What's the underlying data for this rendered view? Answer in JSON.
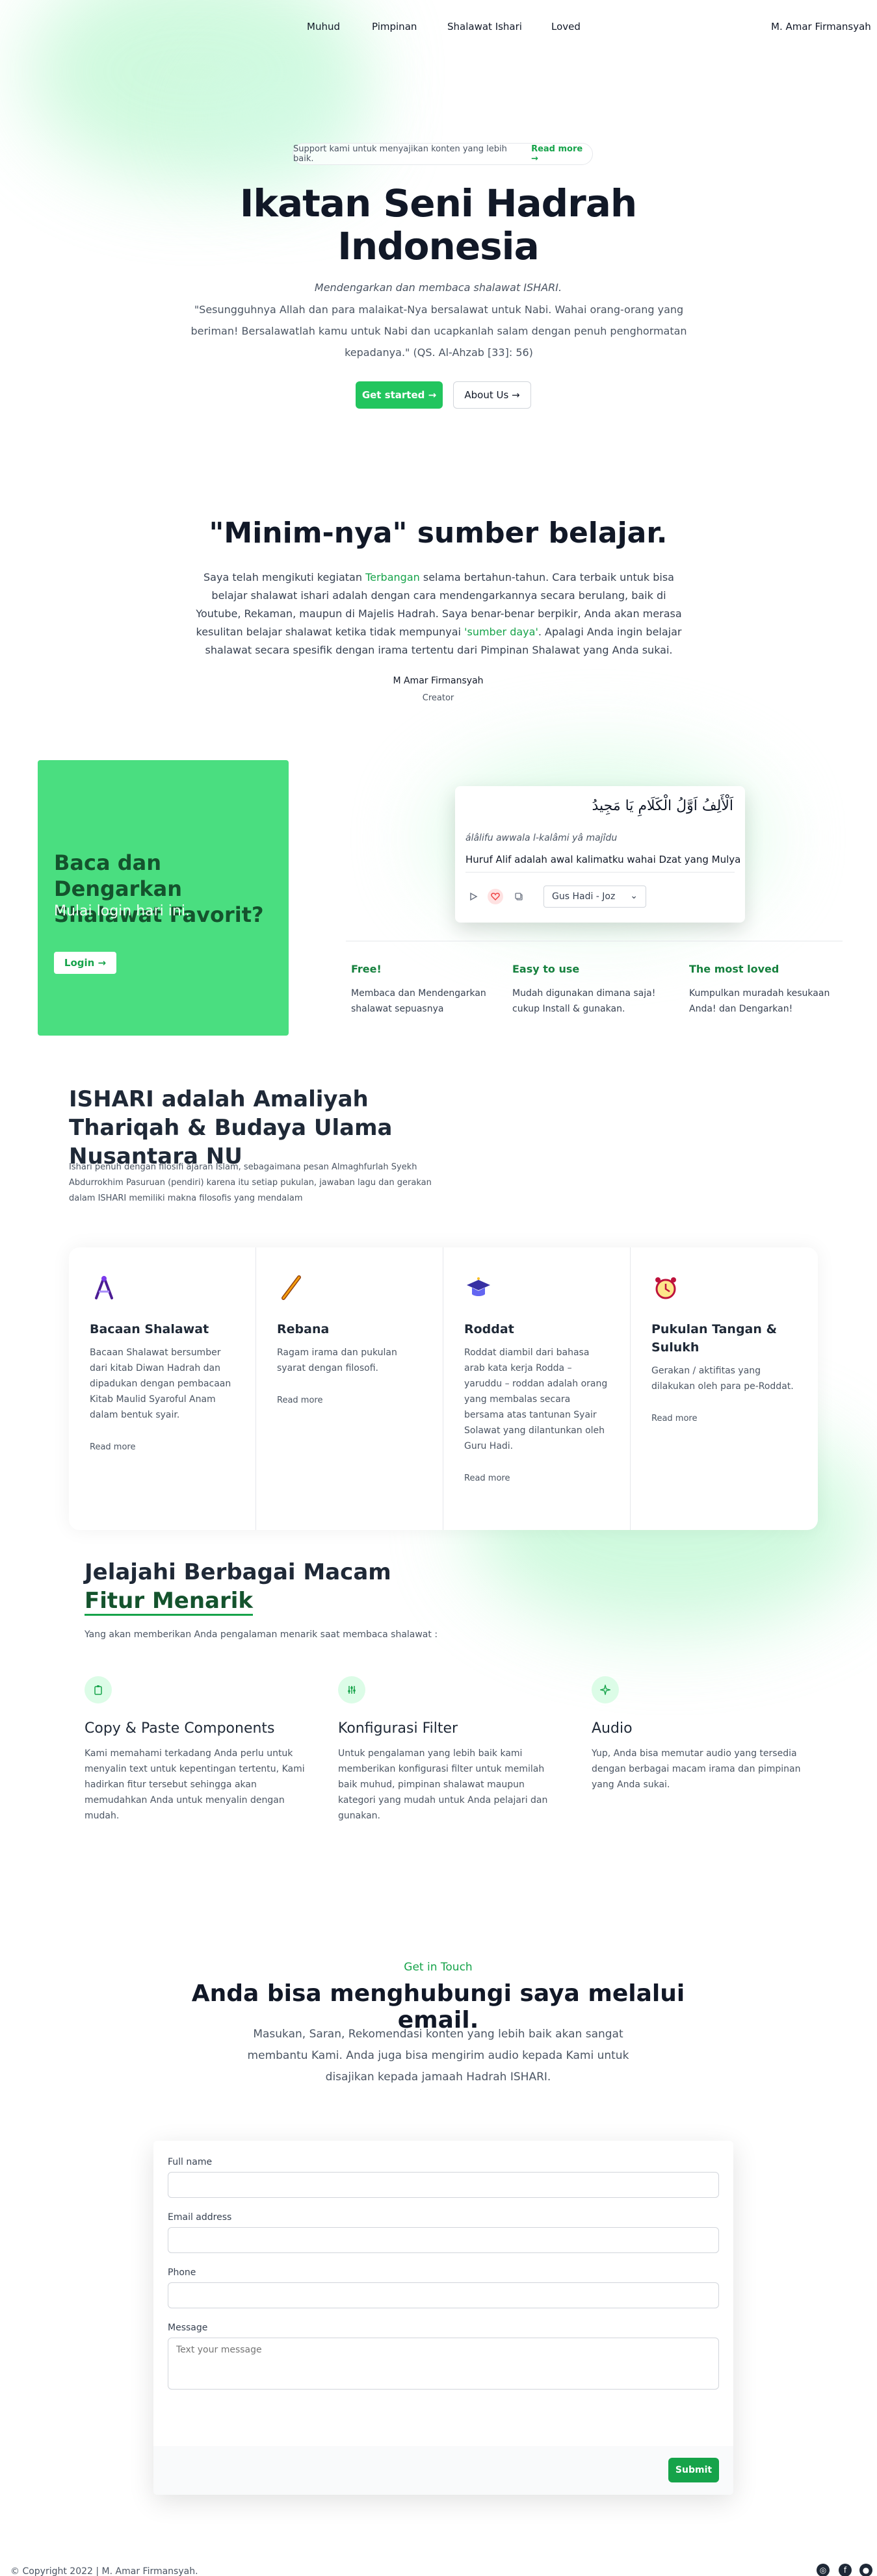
{
  "nav": {
    "items": [
      "Muhud",
      "Pimpinan",
      "Shalawat Ishari",
      "Loved"
    ],
    "user": "M. Amar Firmansyah"
  },
  "hero": {
    "pill_text": "Support kami untuk menyajikan konten yang lebih baik.",
    "pill_link": "Read more →",
    "title_line1": "Ikatan Seni Hadrah",
    "title_line2": "Indonesia",
    "subtitle": "Mendengarkan dan membaca shalawat ISHARI.",
    "quote": "\"Sesungguhnya Allah dan para malaikat-Nya bersalawat untuk Nabi. Wahai orang-orang yang beriman! Bersalawatlah kamu untuk Nabi dan ucapkanlah salam dengan penuh penghormatan kepadanya.\" (QS. Al-Ahzab [33]: 56)",
    "btn_primary": "Get started →",
    "btn_secondary": "About Us →"
  },
  "about": {
    "title": "\"Minim-nya\" sumber belajar.",
    "body_1": "Saya telah mengikuti kegiatan ",
    "body_hl1": "Terbangan",
    "body_2": " selama bertahun-tahun. Cara terbaik untuk bisa belajar shalawat ishari adalah dengan cara mendengarkannya secara berulang, baik di Youtube, Rekaman, maupun di Majelis Hadrah. Saya benar-benar berpikir, Anda akan merasa kesulitan belajar shalawat ketika tidak mempunyai ",
    "body_hl2": "'sumber daya'",
    "body_3": ". Apalagi Anda ingin belajar shalawat secara spesifik dengan irama tertentu dari Pimpinan Shalawat yang Anda sukai.",
    "author": "M Amar Firmansyah",
    "role": "Creator"
  },
  "cta": {
    "title": "Baca dan Dengarkan Shalawat Favorit?",
    "subtitle": "Mulai login hari ini.",
    "button": "Login →"
  },
  "verse": {
    "arabic": "اَلْأَلِفُ اَوَّلُ الْكَلَامِ يَا مَجِيدُ",
    "transliteration": "álâlifu awwala l-kalâmi yâ majîdu",
    "translation": "Huruf Alif adalah awal kalimatku wahai Dzat yang Mulya",
    "select_value": "Gus Hadi - Joz"
  },
  "features3": [
    {
      "title": "Free!",
      "desc": "Membaca dan Mendengarkan shalawat sepuasnya"
    },
    {
      "title": "Easy to use",
      "desc": "Mudah digunakan dimana saja! cukup Install & gunakan."
    },
    {
      "title": "The most loved",
      "desc": "Kumpulkan muradah kesukaan Anda! dan Dengarkan!"
    }
  ],
  "ishari": {
    "title": "ISHARI adalah Amaliyah Thariqah & Budaya Ulama Nusantara NU",
    "body": "Ishari penuh dengan filosifi ajaran Islam, sebagaimana pesan Almaghfurlah Syekh Abdurrokhim Pasuruan (pendiri) karena itu setiap pukulan, jawaban lagu dan gerakan dalam ISHARI memiliki makna filosofis yang mendalam"
  },
  "cards": [
    {
      "icon": "compass-icon",
      "glyph": "✎",
      "title": "Bacaan Shalawat",
      "desc": "Bacaan Shalawat bersumber dari kitab Diwan Hadrah dan dipadukan dengan pembacaan Kitab Maulid Syaroful Anam dalam bentuk syair.",
      "more": "Read more"
    },
    {
      "icon": "flute-icon",
      "glyph": "∕",
      "title": "Rebana",
      "desc": "Ragam irama dan pukulan syarat dengan filosofi.",
      "more": "Read more"
    },
    {
      "icon": "graduation-cap-icon",
      "glyph": "🎓",
      "title": "Roddat",
      "desc": "Roddat diambil dari bahasa arab kata kerja Rodda – yaruddu – roddan adalah orang yang membalas secara bersama atas tantunan Syair Solawat yang dilantunkan oleh Guru Hadi.",
      "more": "Read more"
    },
    {
      "icon": "alarm-clock-icon",
      "glyph": "⏰",
      "title": "Pukulan Tangan & Sulukh",
      "desc": "Gerakan / aktifitas yang dilakukan oleh para pe-Roddat.",
      "more": "Read more"
    }
  ],
  "explore": {
    "title_1": "Jelajahi Berbagai Macam",
    "title_2": "Fitur Menarik",
    "subtitle": "Yang akan memberikan Anda pengalaman menarik saat membaca shalawat :"
  },
  "features": [
    {
      "icon": "clipboard-icon",
      "glyph": "▭",
      "title": "Copy & Paste Components",
      "desc": "Kami memahami terkadang Anda perlu untuk menyalin text untuk kepentingan tertentu, Kami hadirkan fitur tersebut sehingga akan memudahkan Anda untuk menyalin dengan mudah."
    },
    {
      "icon": "sliders-icon",
      "glyph": "⫶",
      "title": "Konfigurasi Filter",
      "desc": "Untuk pengalaman yang lebih baik kami memberikan konfigurasi filter untuk memilah baik muhud, pimpinan shalawat maupun kategori yang mudah untuk Anda pelajari dan gunakan."
    },
    {
      "icon": "sparkle-icon",
      "glyph": "✧",
      "title": "Audio",
      "desc": "Yup, Anda bisa memutar audio yang tersedia dengan berbagai macam irama dan pimpinan yang Anda sukai."
    }
  ],
  "contact": {
    "kicker": "Get in Touch",
    "title": "Anda bisa menghubungi saya melalui email.",
    "body": "Masukan, Saran, Rekomendasi konten yang lebih baik akan sangat membantu Kami. Anda juga bisa mengirim audio kepada Kami untuk disajikan kepada jamaah Hadrah ISHARI.",
    "label_name": "Full name",
    "label_email": "Email address",
    "label_phone": "Phone",
    "label_message": "Message",
    "placeholder_message": "Text your message",
    "submit": "Submit"
  },
  "footer": {
    "copyright": "© Copyright 2022 | M. Amar Firmansyah."
  },
  "colors": {
    "accent": "#22c55e",
    "accent_dark": "#16a34a",
    "cta_bg": "#4ade80"
  }
}
